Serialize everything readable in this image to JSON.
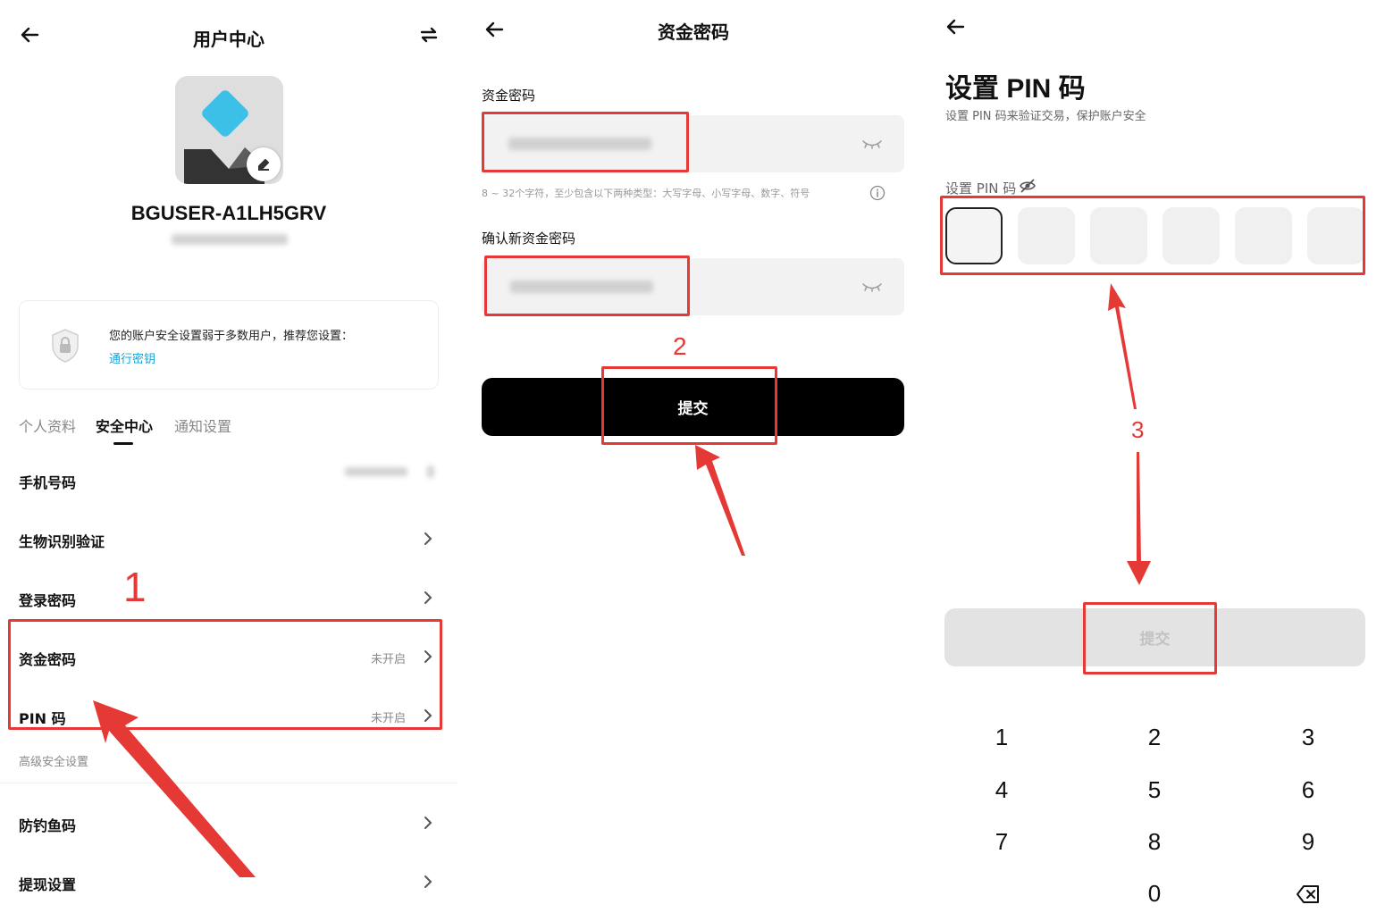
{
  "panel1": {
    "title": "用户中心",
    "username": "BGUSER-A1LH5GRV",
    "notice": {
      "text": "您的账户安全设置弱于多数用户，推荐您设置：",
      "link": "通行密钥"
    },
    "tabs": [
      {
        "label": "个人资料",
        "active": false
      },
      {
        "label": "安全中心",
        "active": true
      },
      {
        "label": "通知设置",
        "active": false
      }
    ],
    "rows": [
      {
        "label": "手机号码",
        "status": ""
      },
      {
        "label": "生物识别验证",
        "status": ""
      },
      {
        "label": "登录密码",
        "status": ""
      },
      {
        "label": "资金密码",
        "status": "未开启"
      },
      {
        "label": "PIN 码",
        "status": "未开启"
      }
    ],
    "advanced_label": "高级安全设置",
    "advanced_rows": [
      {
        "label": "防钓鱼码"
      },
      {
        "label": "提现设置"
      }
    ],
    "annotation": "1"
  },
  "panel2": {
    "title": "资金密码",
    "field1_label": "资金密码",
    "hint": "8 ~ 32个字符，至少包含以下两种类型：大写字母、小写字母、数字、符号",
    "field2_label": "确认新资金密码",
    "submit": "提交",
    "annotation": "2"
  },
  "panel3": {
    "title": "设置 PIN 码",
    "subtitle": "设置 PIN 码来验证交易，保护账户安全",
    "pin_label": "设置 PIN 码",
    "submit": "提交",
    "keypad": [
      "1",
      "2",
      "3",
      "4",
      "5",
      "6",
      "7",
      "8",
      "9",
      "0"
    ],
    "annotation": "3"
  },
  "colors": {
    "accent_red": "#e53935",
    "link_blue": "#1aa1d6",
    "avatar_diamond": "#3cc0e8"
  }
}
